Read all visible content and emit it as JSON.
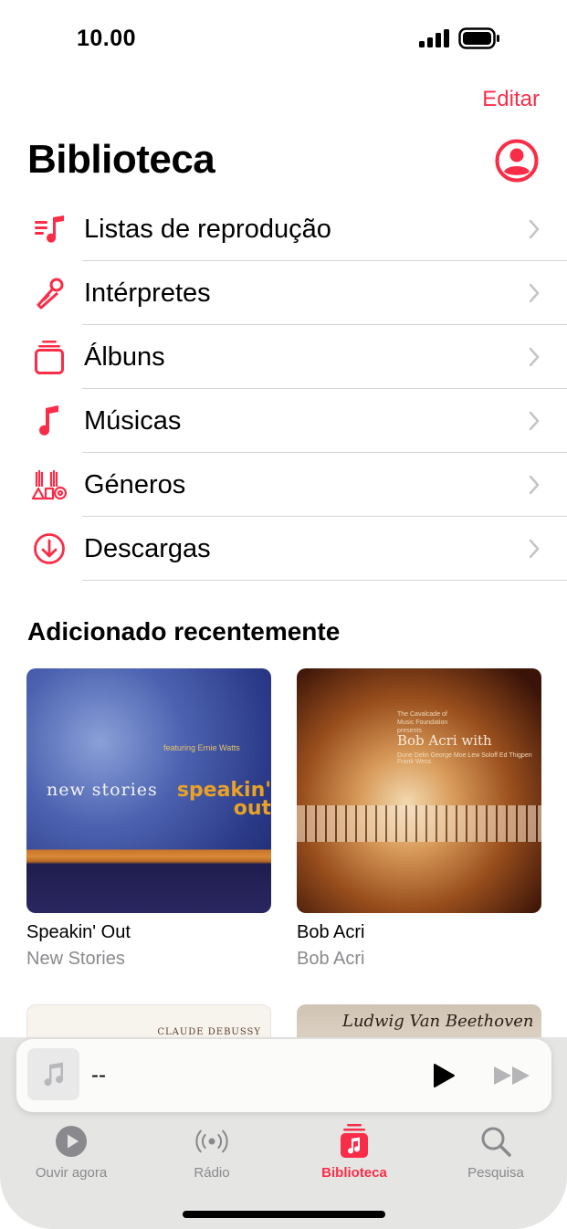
{
  "status": {
    "time": "10.00"
  },
  "header": {
    "edit_label": "Editar",
    "title": "Biblioteca"
  },
  "library": [
    {
      "label": "Listas de reprodução",
      "icon": "playlist-icon"
    },
    {
      "label": "Intérpretes",
      "icon": "microphone-icon"
    },
    {
      "label": "Álbuns",
      "icon": "album-icon"
    },
    {
      "label": "Músicas",
      "icon": "music-note-icon"
    },
    {
      "label": "Géneros",
      "icon": "genres-icon"
    },
    {
      "label": "Descargas",
      "icon": "download-icon"
    }
  ],
  "recent": {
    "title": "Adicionado recentemente",
    "albums": [
      {
        "name": "Speakin' Out",
        "artist": "New Stories",
        "cover_text": [
          "new stories",
          "speakin' out",
          "featuring Ernie Watts"
        ]
      },
      {
        "name": "Bob Acri",
        "artist": "Bob Acri",
        "cover_text": [
          "Bob Acri with",
          "Dune Delin George Moe Lew Soloff Ed Thigpen Frank Wess",
          "The Cavalcade of Music Foundation presents"
        ]
      }
    ],
    "peek": [
      "CLAUDE DEBUSSY",
      "Ludwig Van Beethoven"
    ]
  },
  "mini_player": {
    "title": "--"
  },
  "tabs": [
    {
      "label": "Ouvir agora",
      "icon": "play-circle-icon",
      "active": false
    },
    {
      "label": "Rádio",
      "icon": "radio-icon",
      "active": false
    },
    {
      "label": "Biblioteca",
      "icon": "library-icon",
      "active": true
    },
    {
      "label": "Pesquisa",
      "icon": "search-icon",
      "active": false
    }
  ],
  "colors": {
    "accent": "#fa2d48",
    "secondary_text": "#8a8a8e"
  }
}
